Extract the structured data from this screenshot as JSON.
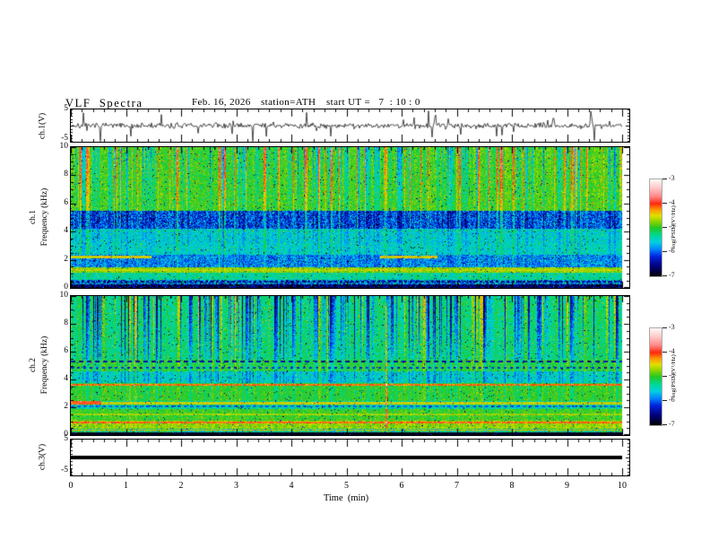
{
  "header": {
    "title": "VLF  Spectra",
    "date": "Feb. 16, 2026",
    "station": "station=ATH",
    "start_ut": "start UT =   7  : 10 : 0"
  },
  "axes": {
    "ch1_wave": {
      "label": "ch.1(V)",
      "yticks": [
        "5",
        "-5"
      ]
    },
    "ch1_spec": {
      "label_channel": "ch.1",
      "label_freq": "Frequency  (kHz)",
      "yticks": [
        "10",
        "8",
        "6",
        "4",
        "2",
        "0"
      ]
    },
    "ch2_spec": {
      "label_channel": "ch.2",
      "label_freq": "Frequency  (kHz)",
      "yticks": [
        "10",
        "8",
        "6",
        "4",
        "2",
        "0"
      ]
    },
    "ch3_wave": {
      "label": "ch.3(V)",
      "yticks": [
        "5",
        "-5"
      ]
    },
    "x": {
      "label": "Time  (min)",
      "ticks": [
        "0",
        "1",
        "2",
        "3",
        "4",
        "5",
        "6",
        "7",
        "8",
        "9",
        "10"
      ]
    }
  },
  "colorbar": {
    "label": "log(PSD)(V²/Hz)",
    "ticks": [
      "-3",
      "-4",
      "-5",
      "-6",
      "-7"
    ],
    "range": [
      -3,
      -7
    ],
    "stops": [
      [
        "-7.0",
        "#000000"
      ],
      [
        "-6.6",
        "#000078"
      ],
      [
        "-6.2",
        "#0020d8"
      ],
      [
        "-5.9",
        "#0080ff"
      ],
      [
        "-5.6",
        "#00d0e0"
      ],
      [
        "-5.3",
        "#00d890"
      ],
      [
        "-5.0",
        "#22c822"
      ],
      [
        "-4.75",
        "#88d400"
      ],
      [
        "-4.5",
        "#e0e000"
      ],
      [
        "-4.25",
        "#ff9800"
      ],
      [
        "-4.0",
        "#ff2810"
      ],
      [
        "-3.7",
        "#ff8888"
      ],
      [
        "-3.35",
        "#ffc8c8"
      ],
      [
        "-3.0",
        "#fffafa"
      ]
    ]
  },
  "chart_data": [
    {
      "id": "ch1_waveform",
      "type": "line",
      "ylabel": "ch.1(V)",
      "ylim": [
        -5,
        5
      ],
      "xlim": [
        0,
        10
      ],
      "xlabel": "Time (min)",
      "description": "Channel 1 broadband time series: continuous noise of about ±1 V with frequent impulsive sferic spikes reaching ±5 V across the whole 10-minute record",
      "gen": {
        "seed": 7,
        "base_amp": 0.85,
        "spike_prob": 0.05,
        "spike_amp_min": 1.2,
        "spike_amp_var": 3.3,
        "neg_bias": 0.6
      }
    },
    {
      "id": "ch1_spectrogram",
      "type": "heatmap",
      "ylabel": "ch.1 Frequency (kHz)",
      "ylim": [
        0,
        10
      ],
      "xlim": [
        0,
        10
      ],
      "zlabel": "log(PSD)(V²/Hz)",
      "zlim": [
        -7,
        -3
      ],
      "description": "VLF spectrogram ch.1: yellow-green band 5.5-10 kHz with red sferic columns, dark blue band 4.2-5.5 kHz, cyan 2.4-4.2 kHz, olive line near 2.2 kHz during 0-1.45 min and 5.6-6.65 min, olive band near 1.1-1.45 kHz, dark speckled rows below 0.6 kHz",
      "gen": {
        "seed": 101,
        "top_f": 5.5,
        "bands": [
          [
            5.5,
            10,
            -4.95,
            0.28,
            1.0
          ],
          [
            4.2,
            5.5,
            -6.05,
            0.5,
            0.45
          ],
          [
            3.2,
            4.2,
            -5.55,
            0.3,
            0.3
          ],
          [
            2.35,
            3.2,
            -5.5,
            0.28,
            0.25
          ],
          [
            1.45,
            2.35,
            -5.85,
            0.4,
            0.2
          ],
          [
            1.1,
            1.45,
            -4.75,
            0.22,
            0.12
          ],
          [
            0.6,
            1.1,
            -5.35,
            0.3,
            0.15
          ],
          [
            0.25,
            0.6,
            -5.9,
            0.75,
            0.1
          ],
          [
            0,
            0.25,
            -6.65,
            0.55,
            0.05
          ]
        ],
        "hlines": [
          [
            2.2,
            0.09,
            -4.5,
            0,
            1.45
          ],
          [
            2.2,
            0.09,
            -4.5,
            5.6,
            6.65
          ],
          [
            4.05,
            0.05,
            -5.15,
            0,
            10,
            4,
            4
          ],
          [
            1.25,
            0.07,
            -4.6,
            0,
            10
          ],
          [
            0.45,
            0.05,
            -6.5,
            0,
            10,
            3,
            3
          ]
        ],
        "vlines": [],
        "streaks": {
          "up_frac": 0.12,
          "up_base": 0.55,
          "up_var": 0.85,
          "down_frac": 0.22,
          "down_base": 0.35,
          "down_var": 0.75,
          "mid_var": 0.35
        }
      }
    },
    {
      "id": "ch2_spectrogram",
      "type": "heatmap",
      "ylabel": "ch.2 Frequency (kHz)",
      "ylim": [
        0,
        10
      ],
      "xlim": [
        0,
        10
      ],
      "zlabel": "log(PSD)(V²/Hz)",
      "zlim": [
        -7,
        -3
      ],
      "description": "VLF spectrogram ch.2: teal-green 5.4-10 kHz with many dark-blue vertical streaks, dashed dark lines near 5.3 and 4.85 kHz, red-orange lines near 3.6 and 0.9 kHz, yellow-orange line near 2.3 kHz (bright 0-0.55 min), yellow-green low band, black rows below 0.2 kHz, yellow vertical event near 5.7 min",
      "gen": {
        "seed": 202,
        "top_f": 5.4,
        "bands": [
          [
            5.4,
            10,
            -5.25,
            0.3,
            1.0
          ],
          [
            4.6,
            5.4,
            -5.05,
            0.27,
            0.35
          ],
          [
            3.75,
            4.6,
            -5.5,
            0.3,
            0.3
          ],
          [
            2.45,
            3.75,
            -5.0,
            0.22,
            0.2
          ],
          [
            1.85,
            2.45,
            -5.35,
            0.38,
            0.15
          ],
          [
            1.05,
            1.85,
            -4.95,
            0.25,
            0.1
          ],
          [
            0.45,
            1.05,
            -4.7,
            0.25,
            0.1
          ],
          [
            0.2,
            0.45,
            -5.3,
            0.6,
            0.05
          ],
          [
            0,
            0.2,
            -6.5,
            0.7,
            0.05
          ]
        ],
        "hlines": [
          [
            5.3,
            0.06,
            -6.4,
            0,
            10,
            5,
            4
          ],
          [
            4.85,
            0.05,
            -6.2,
            0,
            10,
            3,
            4
          ],
          [
            3.6,
            0.07,
            -4.15,
            0,
            10
          ],
          [
            2.3,
            0.08,
            -4.55,
            0,
            10
          ],
          [
            2.32,
            0.1,
            -4.0,
            0,
            0.55
          ],
          [
            2.05,
            0.05,
            -6.0,
            0,
            10,
            4,
            3
          ],
          [
            1.5,
            0.05,
            -4.7,
            0,
            10
          ],
          [
            0.9,
            0.06,
            -4.1,
            0,
            10
          ],
          [
            0.35,
            0.05,
            -4.45,
            0,
            10
          ],
          [
            0.15,
            0.04,
            -6.9,
            0,
            10
          ],
          [
            0.06,
            0.04,
            -6.9,
            0,
            10
          ]
        ],
        "vlines": [
          [
            5.72,
            0.9,
            0.5,
            9.5
          ]
        ],
        "streaks": {
          "up_frac": 0.08,
          "up_base": 0.45,
          "up_var": 0.55,
          "down_frac": 0.3,
          "down_base": 0.5,
          "down_var": 1.1,
          "mid_var": 0.4
        }
      }
    },
    {
      "id": "ch3_waveform",
      "type": "line",
      "ylabel": "ch.3(V)",
      "ylim": [
        -5,
        5
      ],
      "xlim": [
        0,
        10
      ],
      "value": 0,
      "description": "Channel 3: flat thick black trace at 0 V for the whole record (channel off/saturated)"
    }
  ]
}
